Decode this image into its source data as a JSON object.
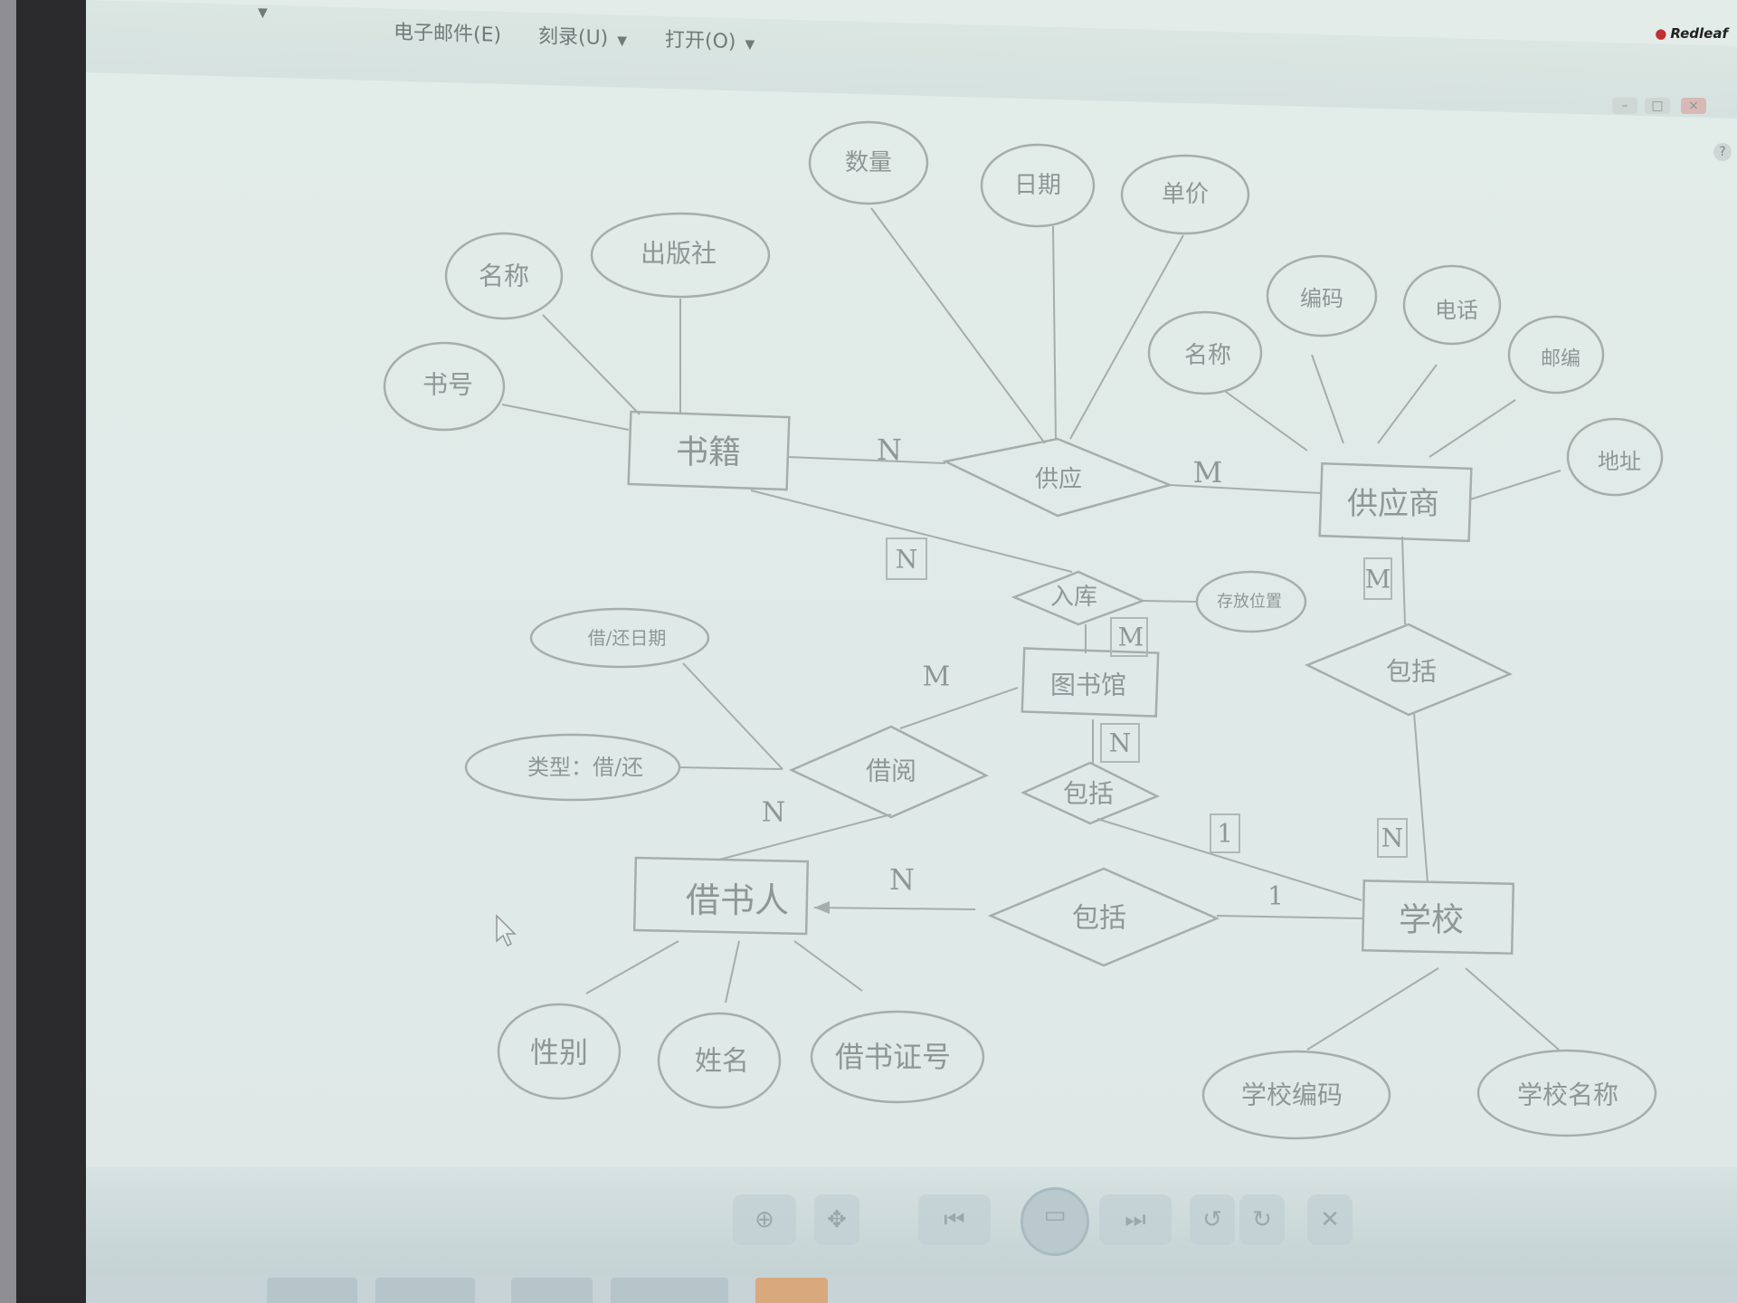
{
  "menu": {
    "items": [
      {
        "label": "",
        "caret": "▼"
      },
      {
        "label": "电子邮件(E)",
        "caret": ""
      },
      {
        "label": "刻录(U)",
        "caret": "▼"
      },
      {
        "label": "打开(O)",
        "caret": "▼"
      }
    ],
    "brand": "Redleaf"
  },
  "diagram": {
    "entities": {
      "book": "书籍",
      "supplier": "供应商",
      "library": "图书馆",
      "borrower": "借书人",
      "school": "学校"
    },
    "relationships": {
      "supply": "供应",
      "stock_in": "入库",
      "borrow": "借阅",
      "include_library": "包括",
      "include_supplier": "包括",
      "include_borrower": "包括"
    },
    "attributes": {
      "quantity": "数量",
      "date": "日期",
      "unit_price": "单价",
      "book_name": "名称",
      "publisher": "出版社",
      "book_no": "书号",
      "supplier_name": "名称",
      "code": "编码",
      "phone": "电话",
      "postcode": "邮编",
      "address": "地址",
      "storage_location": "存放位置",
      "borrow_date": "借/还日期",
      "borrow_type": "类型：借/还",
      "gender": "性别",
      "person_name": "姓名",
      "card_no": "借书证号",
      "school_code": "学校编码",
      "school_name": "学校名称"
    },
    "cardinalities": {
      "book_supply": "N",
      "supply_supplier": "M",
      "book_stock": "N",
      "library_stock": "M",
      "supplier_include": "M",
      "library_borrow": "M",
      "borrower_borrow": "N",
      "library_include": "N",
      "include_school_1": "1",
      "include_school_2": "N",
      "borrower_include": "N",
      "school_include": "1"
    }
  },
  "toolbar": {
    "zoom_icon": "zoom-icon",
    "fit_icon": "actual-size-icon",
    "prev_icon": "previous-icon",
    "slideshow_icon": "slideshow-icon",
    "next_icon": "next-icon",
    "rotate_left_icon": "rotate-left-icon",
    "rotate_right_icon": "rotate-right-icon",
    "delete_icon": "delete-icon"
  }
}
